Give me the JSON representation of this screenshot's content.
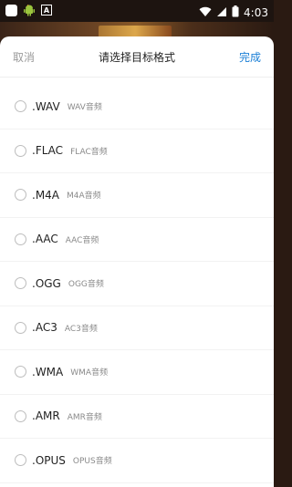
{
  "status_bar": {
    "time": "4:03",
    "icons": [
      "square-app-icon",
      "android-bot-icon",
      "a-box-icon",
      "wifi-icon",
      "signal-icon",
      "battery-icon"
    ]
  },
  "sheet": {
    "cancel_label": "取消",
    "title": "请选择目标格式",
    "done_label": "完成",
    "accent_color": "#1a7fd6"
  },
  "formats": [
    {
      "ext": ".WAV",
      "desc": "WAV音频"
    },
    {
      "ext": ".FLAC",
      "desc": "FLAC音频"
    },
    {
      "ext": ".M4A",
      "desc": "M4A音频"
    },
    {
      "ext": ".AAC",
      "desc": "AAC音频"
    },
    {
      "ext": ".OGG",
      "desc": "OGG音频"
    },
    {
      "ext": ".AC3",
      "desc": "AC3音频"
    },
    {
      "ext": ".WMA",
      "desc": "WMA音频"
    },
    {
      "ext": ".AMR",
      "desc": "AMR音频"
    },
    {
      "ext": ".OPUS",
      "desc": "OPUS音频"
    }
  ]
}
